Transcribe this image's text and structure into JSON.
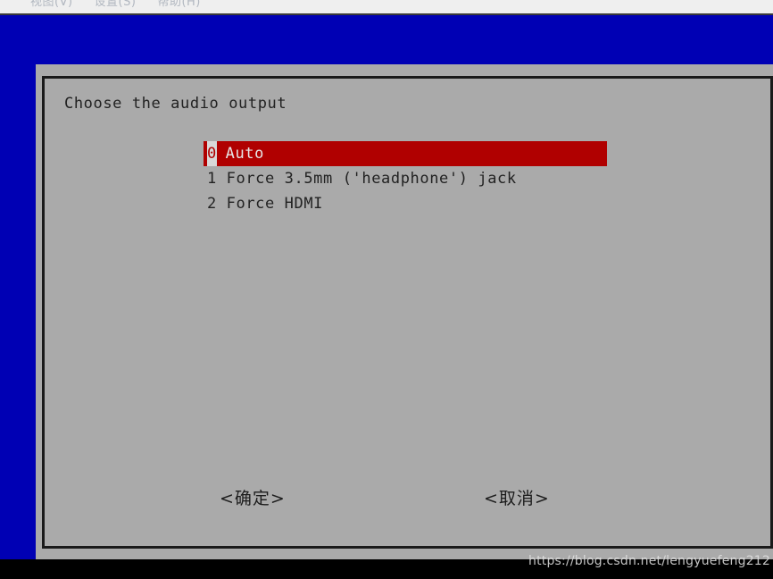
{
  "menubar": {
    "items": [
      {
        "label": "视图(V)"
      },
      {
        "label": "设置(S)"
      },
      {
        "label": "帮助(H)"
      }
    ]
  },
  "dialog": {
    "prompt": "Choose the audio output",
    "options": [
      {
        "index": "0",
        "label": "Auto",
        "text": "0 Auto",
        "selected": true
      },
      {
        "index": "1",
        "label": "Force 3.5mm ('headphone') jack",
        "text": "1 Force 3.5mm ('headphone') jack",
        "selected": false
      },
      {
        "index": "2",
        "label": "Force HDMI",
        "text": "2 Force HDMI",
        "selected": false
      }
    ],
    "buttons": {
      "ok": "<确定>",
      "cancel": "<取消>"
    }
  },
  "watermark": {
    "text": "https://blog.csdn.net/lengyuefeng212"
  },
  "colors": {
    "desktop_blue": "#0000b4",
    "dialog_gray": "#aaaaaa",
    "highlight_red": "#b00000",
    "highlight_text": "#e6e6e6",
    "border_dark": "#1a1a1a",
    "menubar_bg": "#efefef",
    "terminal_black": "#000000"
  }
}
